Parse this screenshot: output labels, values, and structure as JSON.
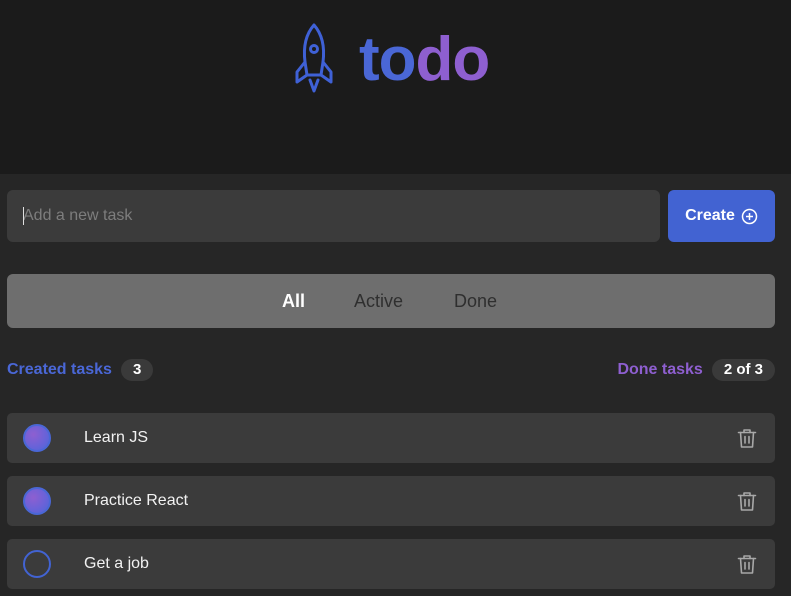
{
  "header": {
    "logo_icon": "rocket-icon",
    "title_part1": "to",
    "title_part2": "do",
    "colors": {
      "blue": "#4a67d6",
      "purple": "#8e5fd0"
    }
  },
  "new_task": {
    "placeholder": "Add a new task",
    "value": "",
    "create_label": "Create",
    "create_icon": "plus-circle-icon"
  },
  "filters": {
    "tabs": [
      {
        "label": "All",
        "active": true
      },
      {
        "label": "Active",
        "active": false
      },
      {
        "label": "Done",
        "active": false
      }
    ]
  },
  "stats": {
    "created_label": "Created tasks",
    "created_count": "3",
    "done_label": "Done tasks",
    "done_count": "2 of 3"
  },
  "tasks": [
    {
      "text": "Learn JS",
      "done": true,
      "delete_icon": "trash-icon"
    },
    {
      "text": "Practice React",
      "done": true,
      "delete_icon": "trash-icon"
    },
    {
      "text": "Get a job",
      "done": false,
      "delete_icon": "trash-icon"
    }
  ]
}
